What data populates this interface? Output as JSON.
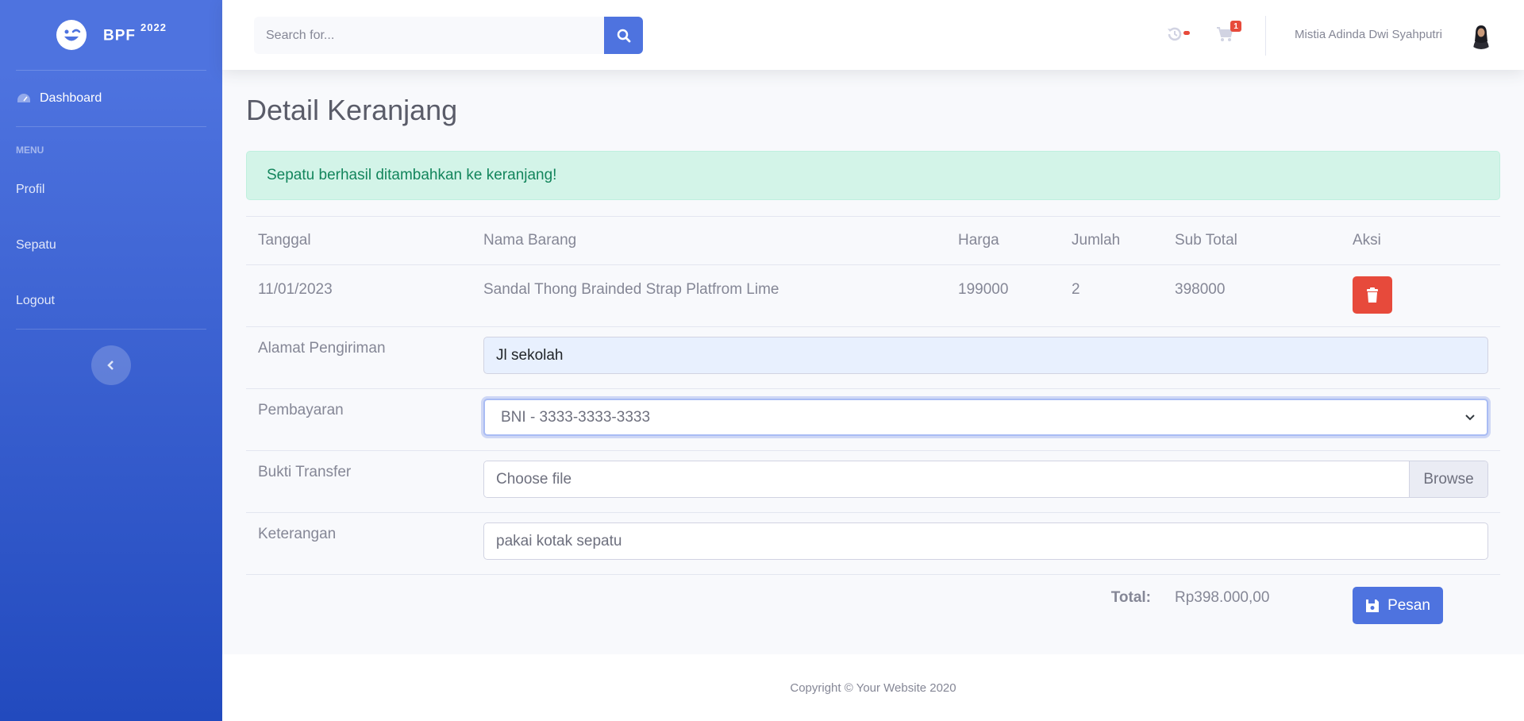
{
  "brand": {
    "name": "BPF",
    "sup": "2022"
  },
  "sidebar": {
    "dashboard": "Dashboard",
    "heading": "MENU",
    "items": [
      {
        "label": "Profil"
      },
      {
        "label": "Sepatu"
      },
      {
        "label": "Logout"
      }
    ]
  },
  "topbar": {
    "search_placeholder": "Search for...",
    "cart_count": "1",
    "user_name": "Mistia Adinda Dwi Syahputri"
  },
  "main": {
    "title": "Detail Keranjang",
    "alert": "Sepatu berhasil ditambahkan ke keranjang!",
    "table": {
      "headers": [
        "Tanggal",
        "Nama Barang",
        "Harga",
        "Jumlah",
        "Sub Total",
        "Aksi"
      ],
      "row": {
        "tanggal": "11/01/2023",
        "nama": "Sandal Thong Brainded Strap Platfrom Lime",
        "harga": "199000",
        "jumlah": "2",
        "subtotal": "398000"
      }
    },
    "form": {
      "alamat_label": "Alamat Pengiriman",
      "alamat_value": "Jl sekolah",
      "pembayaran_label": "Pembayaran",
      "pembayaran_value": "BNI - 3333-3333-3333",
      "bukti_label": "Bukti Transfer",
      "bukti_placeholder": "Choose file",
      "browse_label": "Browse",
      "keterangan_label": "Keterangan",
      "keterangan_value": "pakai kotak sepatu"
    },
    "total_label": "Total:",
    "total_value": "Rp398.000,00",
    "pesan_label": "Pesan"
  },
  "footer": {
    "text": "Copyright © Your Website 2020"
  },
  "colors": {
    "primary": "#4e73df",
    "danger": "#e74a3b",
    "success_bg": "#d3f4e8"
  },
  "icons": [
    "laugh-wink-icon",
    "tachometer-icon",
    "chevron-left-icon",
    "search-icon",
    "history-icon",
    "cart-icon",
    "trash-icon",
    "save-icon",
    "chevron-down-icon"
  ]
}
